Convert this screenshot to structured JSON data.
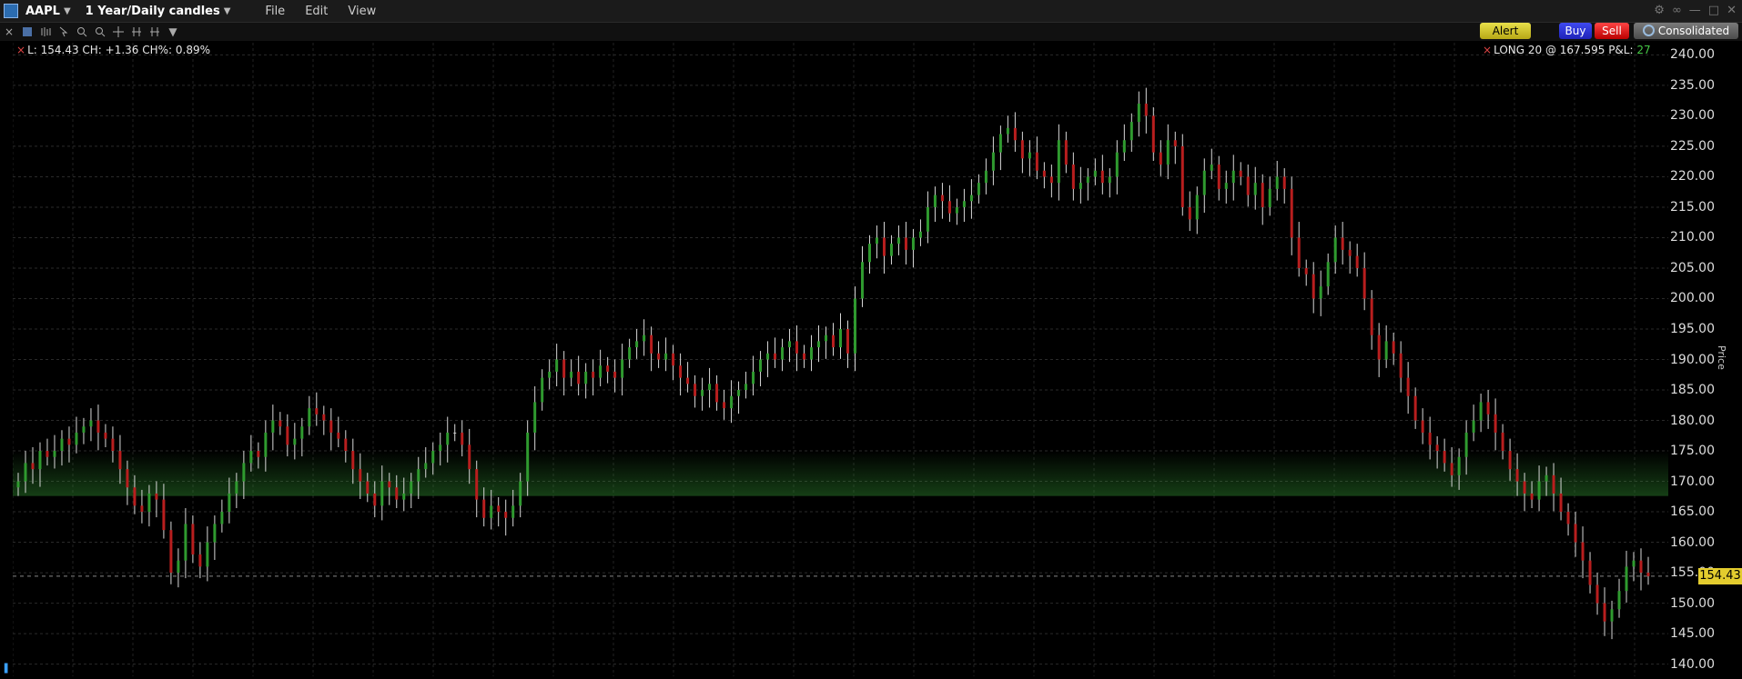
{
  "window": {
    "symbol": "AAPL",
    "title": "1 Year/Daily candles",
    "menus": [
      "File",
      "Edit",
      "View"
    ]
  },
  "toolbar_icons": [
    "chart-type-icon",
    "bar-settings-icon",
    "cursor-icon",
    "zoom-in-icon",
    "zoom-out-icon",
    "crosshair-icon",
    "compare-icon",
    "dropdown-icon"
  ],
  "actions": {
    "alert": "Alert",
    "buy": "Buy",
    "sell": "Sell",
    "feed": "Consolidated"
  },
  "readout": "L: 154.43 CH: +1.36 CH%: 0.89%",
  "position": {
    "text": "LONG 20 @ 167.595 P&L:",
    "pnl": "27",
    "pnl_color": "#46c846"
  },
  "price_axis": {
    "title": "Price",
    "ticks": [
      "240.00",
      "235.00",
      "230.00",
      "225.00",
      "220.00",
      "215.00",
      "210.00",
      "205.00",
      "200.00",
      "195.00",
      "190.00",
      "185.00",
      "180.00",
      "175.00",
      "170.00",
      "165.00",
      "160.00",
      "155.00",
      "150.00",
      "145.00",
      "140.00"
    ],
    "last": "154.43"
  },
  "colors": {
    "up": "#2f9a2f",
    "down": "#b81e1e",
    "neutral": "#d0d0d0",
    "position_band": "#2f8a2f",
    "last_tag": "#e3cc2e"
  },
  "chart_data": {
    "type": "candlestick",
    "symbol": "AAPL",
    "ylim": [
      138,
      242
    ],
    "position_band": [
      167.595,
      175
    ],
    "last_price": 154.43,
    "closes": [
      170,
      173,
      172,
      175,
      174,
      175,
      177,
      176,
      178,
      179,
      180,
      178,
      177,
      175,
      172,
      169,
      166,
      165,
      168,
      167,
      162,
      155,
      157,
      163,
      158,
      156,
      160,
      163,
      165,
      168,
      170,
      173,
      175,
      174,
      178,
      180,
      179,
      176,
      177,
      179,
      182,
      181,
      180,
      178,
      177,
      175,
      172,
      170,
      168,
      166,
      170,
      169,
      167,
      168,
      170,
      172,
      173,
      175,
      176,
      178,
      178,
      176,
      172,
      167,
      164,
      166,
      165,
      164,
      166,
      170,
      178,
      183,
      187,
      188,
      190,
      187,
      188,
      186,
      188,
      187,
      189,
      188,
      187,
      190,
      192,
      193,
      194,
      191,
      190,
      191,
      189,
      187,
      186,
      184,
      185,
      186,
      183,
      182,
      184,
      185,
      186,
      188,
      190,
      191,
      190,
      192,
      193,
      191,
      190,
      192,
      193,
      194,
      192,
      195,
      191,
      200,
      206,
      209,
      210,
      207,
      209,
      210,
      208,
      210,
      211,
      215,
      217,
      216,
      214,
      215,
      216,
      217,
      219,
      221,
      224,
      227,
      228,
      226,
      223,
      224,
      221,
      220,
      219,
      226,
      222,
      218,
      219,
      220,
      221,
      219,
      220,
      224,
      226,
      229,
      232,
      230,
      224,
      222,
      226,
      225,
      215,
      213,
      217,
      221,
      222,
      218,
      219,
      221,
      220,
      217,
      219,
      215,
      218,
      220,
      218,
      210,
      205,
      204,
      200,
      202,
      206,
      210,
      208,
      207,
      205,
      200,
      194,
      190,
      193,
      191,
      187,
      184,
      180,
      178,
      176,
      175,
      173,
      171,
      174,
      178,
      180,
      183,
      181,
      178,
      175,
      172,
      170,
      168,
      167,
      170,
      171,
      168,
      165,
      163,
      160,
      157,
      153,
      150,
      147,
      149,
      152,
      156,
      157,
      155,
      154.43
    ]
  }
}
